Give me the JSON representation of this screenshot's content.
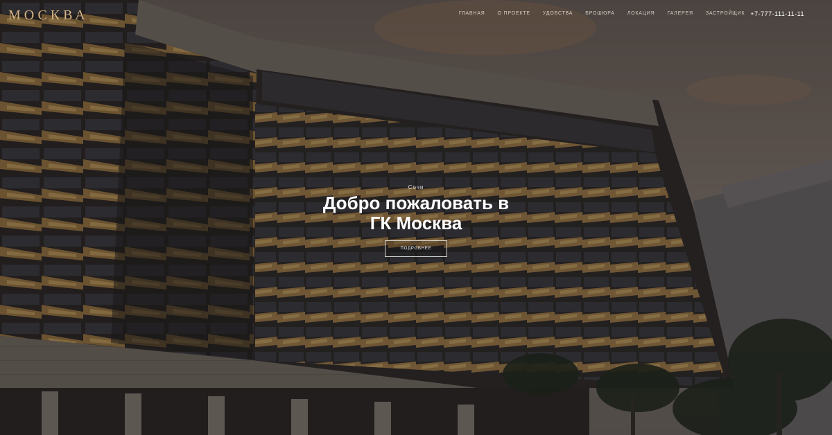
{
  "brand": {
    "tagline": "",
    "name": "МОСКВА"
  },
  "nav": {
    "items": [
      {
        "label": "ГЛАВНАЯ"
      },
      {
        "label": "О ПРОЕКТЕ"
      },
      {
        "label": "УДОБСТВА"
      },
      {
        "label": "БРОШЮРА"
      },
      {
        "label": "ЛОКАЦИЯ"
      },
      {
        "label": "ГАЛЕРЕЯ"
      },
      {
        "label": "ЗАСТРОЙЩИК"
      }
    ],
    "phone": "+7-777-111-11-11"
  },
  "hero": {
    "city": "Сочи",
    "title_line1": "Добро пожаловать в",
    "title_line2": "ГК Москва",
    "button_label": "ПОДРОБНЕЕ",
    "image_icon": "building-facade-photo"
  },
  "colors": {
    "brand_gold": "#d4b483",
    "text_white": "#ffffff"
  }
}
